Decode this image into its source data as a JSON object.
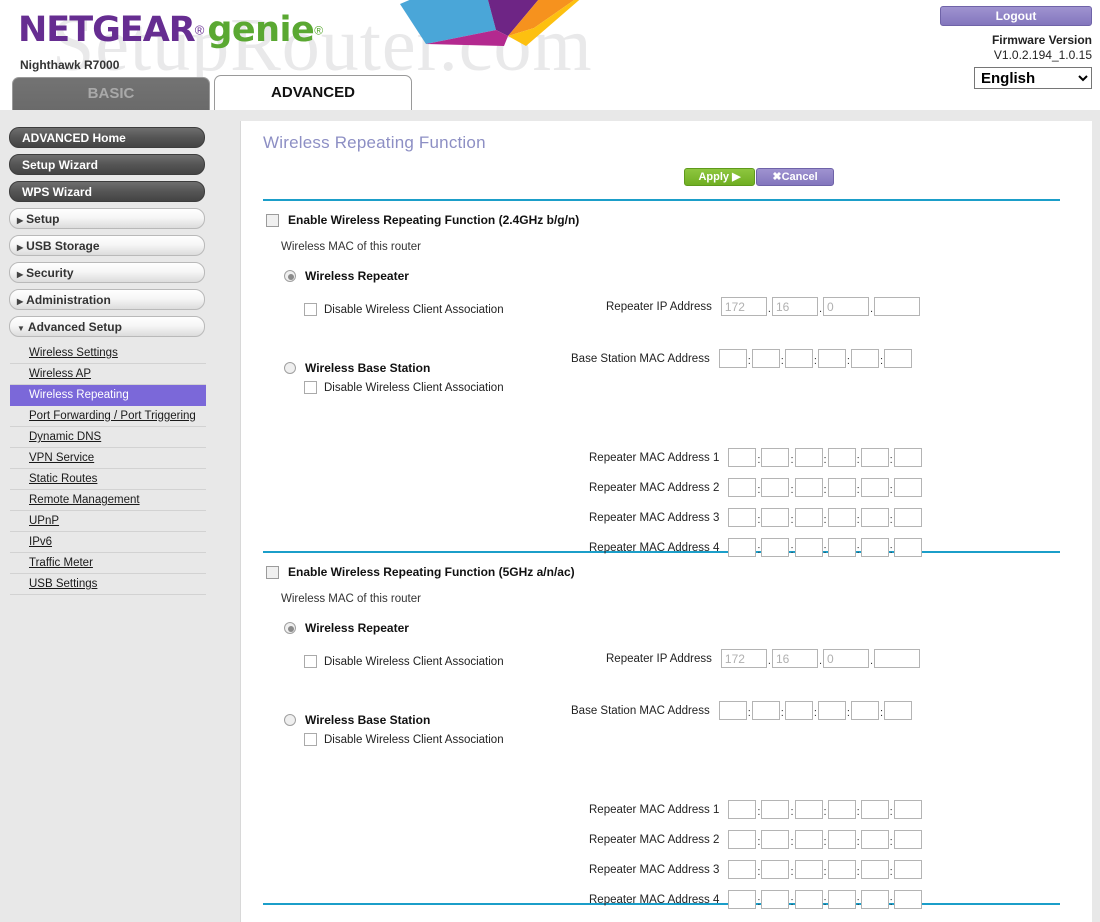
{
  "header": {
    "watermark": "SetupRouter.com",
    "brand_netgear": "NETGEAR",
    "brand_reg": "®",
    "brand_genie": "genie",
    "brand_reg2": "®",
    "model": "Nighthawk R7000",
    "logout_label": "Logout",
    "firmware_label": "Firmware Version",
    "firmware_value": "V1.0.2.194_1.0.15",
    "language_selected": "English",
    "language_options": [
      "English"
    ],
    "tabs": [
      {
        "label": "BASIC",
        "active": false
      },
      {
        "label": "ADVANCED",
        "active": true
      }
    ]
  },
  "sidebar": {
    "buttons": [
      {
        "label": "ADVANCED Home",
        "style": "dark"
      },
      {
        "label": "Setup Wizard",
        "style": "dark"
      },
      {
        "label": "WPS Wizard",
        "style": "dark"
      },
      {
        "label": "Setup",
        "style": "light",
        "arrow": "▶"
      },
      {
        "label": "USB Storage",
        "style": "light",
        "arrow": "▶"
      },
      {
        "label": "Security",
        "style": "light",
        "arrow": "▶"
      },
      {
        "label": "Administration",
        "style": "light",
        "arrow": "▶"
      },
      {
        "label": "Advanced Setup",
        "style": "light",
        "arrow": "▼"
      }
    ],
    "sublinks": [
      {
        "label": "Wireless Settings",
        "active": false
      },
      {
        "label": "Wireless AP",
        "active": false
      },
      {
        "label": "Wireless Repeating",
        "active": true
      },
      {
        "label": "Port Forwarding / Port Triggering",
        "active": false
      },
      {
        "label": "Dynamic DNS",
        "active": false
      },
      {
        "label": "VPN Service",
        "active": false
      },
      {
        "label": "Static Routes",
        "active": false
      },
      {
        "label": "Remote Management",
        "active": false
      },
      {
        "label": "UPnP",
        "active": false
      },
      {
        "label": "IPv6",
        "active": false
      },
      {
        "label": "Traffic Meter",
        "active": false
      },
      {
        "label": "USB Settings",
        "active": false
      }
    ]
  },
  "main": {
    "title": "Wireless Repeating Function",
    "apply_label": "Apply ▶",
    "cancel_label": "Cancel",
    "cancel_icon": "✖",
    "section_24": {
      "enable_label": "Enable Wireless Repeating Function (2.4GHz b/g/n)",
      "enable_checked": false,
      "wireless_mac_label": "Wireless MAC of this router",
      "wireless_mac_value": "",
      "repeater_radio_label": "Wireless Repeater",
      "repeater_radio_selected": true,
      "repeater_disable_assoc_label": "Disable Wireless Client Association",
      "repeater_disable_assoc_checked": false,
      "repeater_ip_label": "Repeater IP Address",
      "repeater_ip": [
        "172",
        "16",
        "0",
        ""
      ],
      "base_mac_label": "Base Station MAC Address",
      "base_mac": [
        "",
        "",
        "",
        "",
        "",
        ""
      ],
      "base_radio_label": "Wireless Base Station",
      "base_radio_selected": false,
      "base_disable_assoc_label": "Disable Wireless Client Association",
      "base_disable_assoc_checked": false,
      "repeater_macs": [
        {
          "label": "Repeater MAC Address 1",
          "octets": [
            "",
            "",
            "",
            "",
            "",
            ""
          ]
        },
        {
          "label": "Repeater MAC Address 2",
          "octets": [
            "",
            "",
            "",
            "",
            "",
            ""
          ]
        },
        {
          "label": "Repeater MAC Address 3",
          "octets": [
            "",
            "",
            "",
            "",
            "",
            ""
          ]
        },
        {
          "label": "Repeater MAC Address 4",
          "octets": [
            "",
            "",
            "",
            "",
            "",
            ""
          ]
        }
      ]
    },
    "section_5": {
      "enable_label": "Enable Wireless Repeating Function (5GHz a/n/ac)",
      "enable_checked": false,
      "wireless_mac_label": "Wireless MAC of this router",
      "wireless_mac_value": "",
      "repeater_radio_label": "Wireless Repeater",
      "repeater_radio_selected": true,
      "repeater_disable_assoc_label": "Disable Wireless Client Association",
      "repeater_disable_assoc_checked": false,
      "repeater_ip_label": "Repeater IP Address",
      "repeater_ip": [
        "172",
        "16",
        "0",
        ""
      ],
      "base_mac_label": "Base Station MAC Address",
      "base_mac": [
        "",
        "",
        "",
        "",
        "",
        ""
      ],
      "base_radio_label": "Wireless Base Station",
      "base_radio_selected": false,
      "base_disable_assoc_label": "Disable Wireless Client Association",
      "base_disable_assoc_checked": false,
      "repeater_macs": [
        {
          "label": "Repeater MAC Address 1",
          "octets": [
            "",
            "",
            "",
            "",
            "",
            ""
          ]
        },
        {
          "label": "Repeater MAC Address 2",
          "octets": [
            "",
            "",
            "",
            "",
            "",
            ""
          ]
        },
        {
          "label": "Repeater MAC Address 3",
          "octets": [
            "",
            "",
            "",
            "",
            "",
            ""
          ]
        },
        {
          "label": "Repeater MAC Address 4",
          "octets": [
            "",
            "",
            "",
            "",
            "",
            ""
          ]
        }
      ]
    }
  },
  "colors": {
    "brand_purple": "#662d91",
    "brand_green": "#5aa832",
    "divider_blue": "#1b9ec9",
    "accent_active": "#7b68d9",
    "apply_green": "#7fba2e"
  }
}
